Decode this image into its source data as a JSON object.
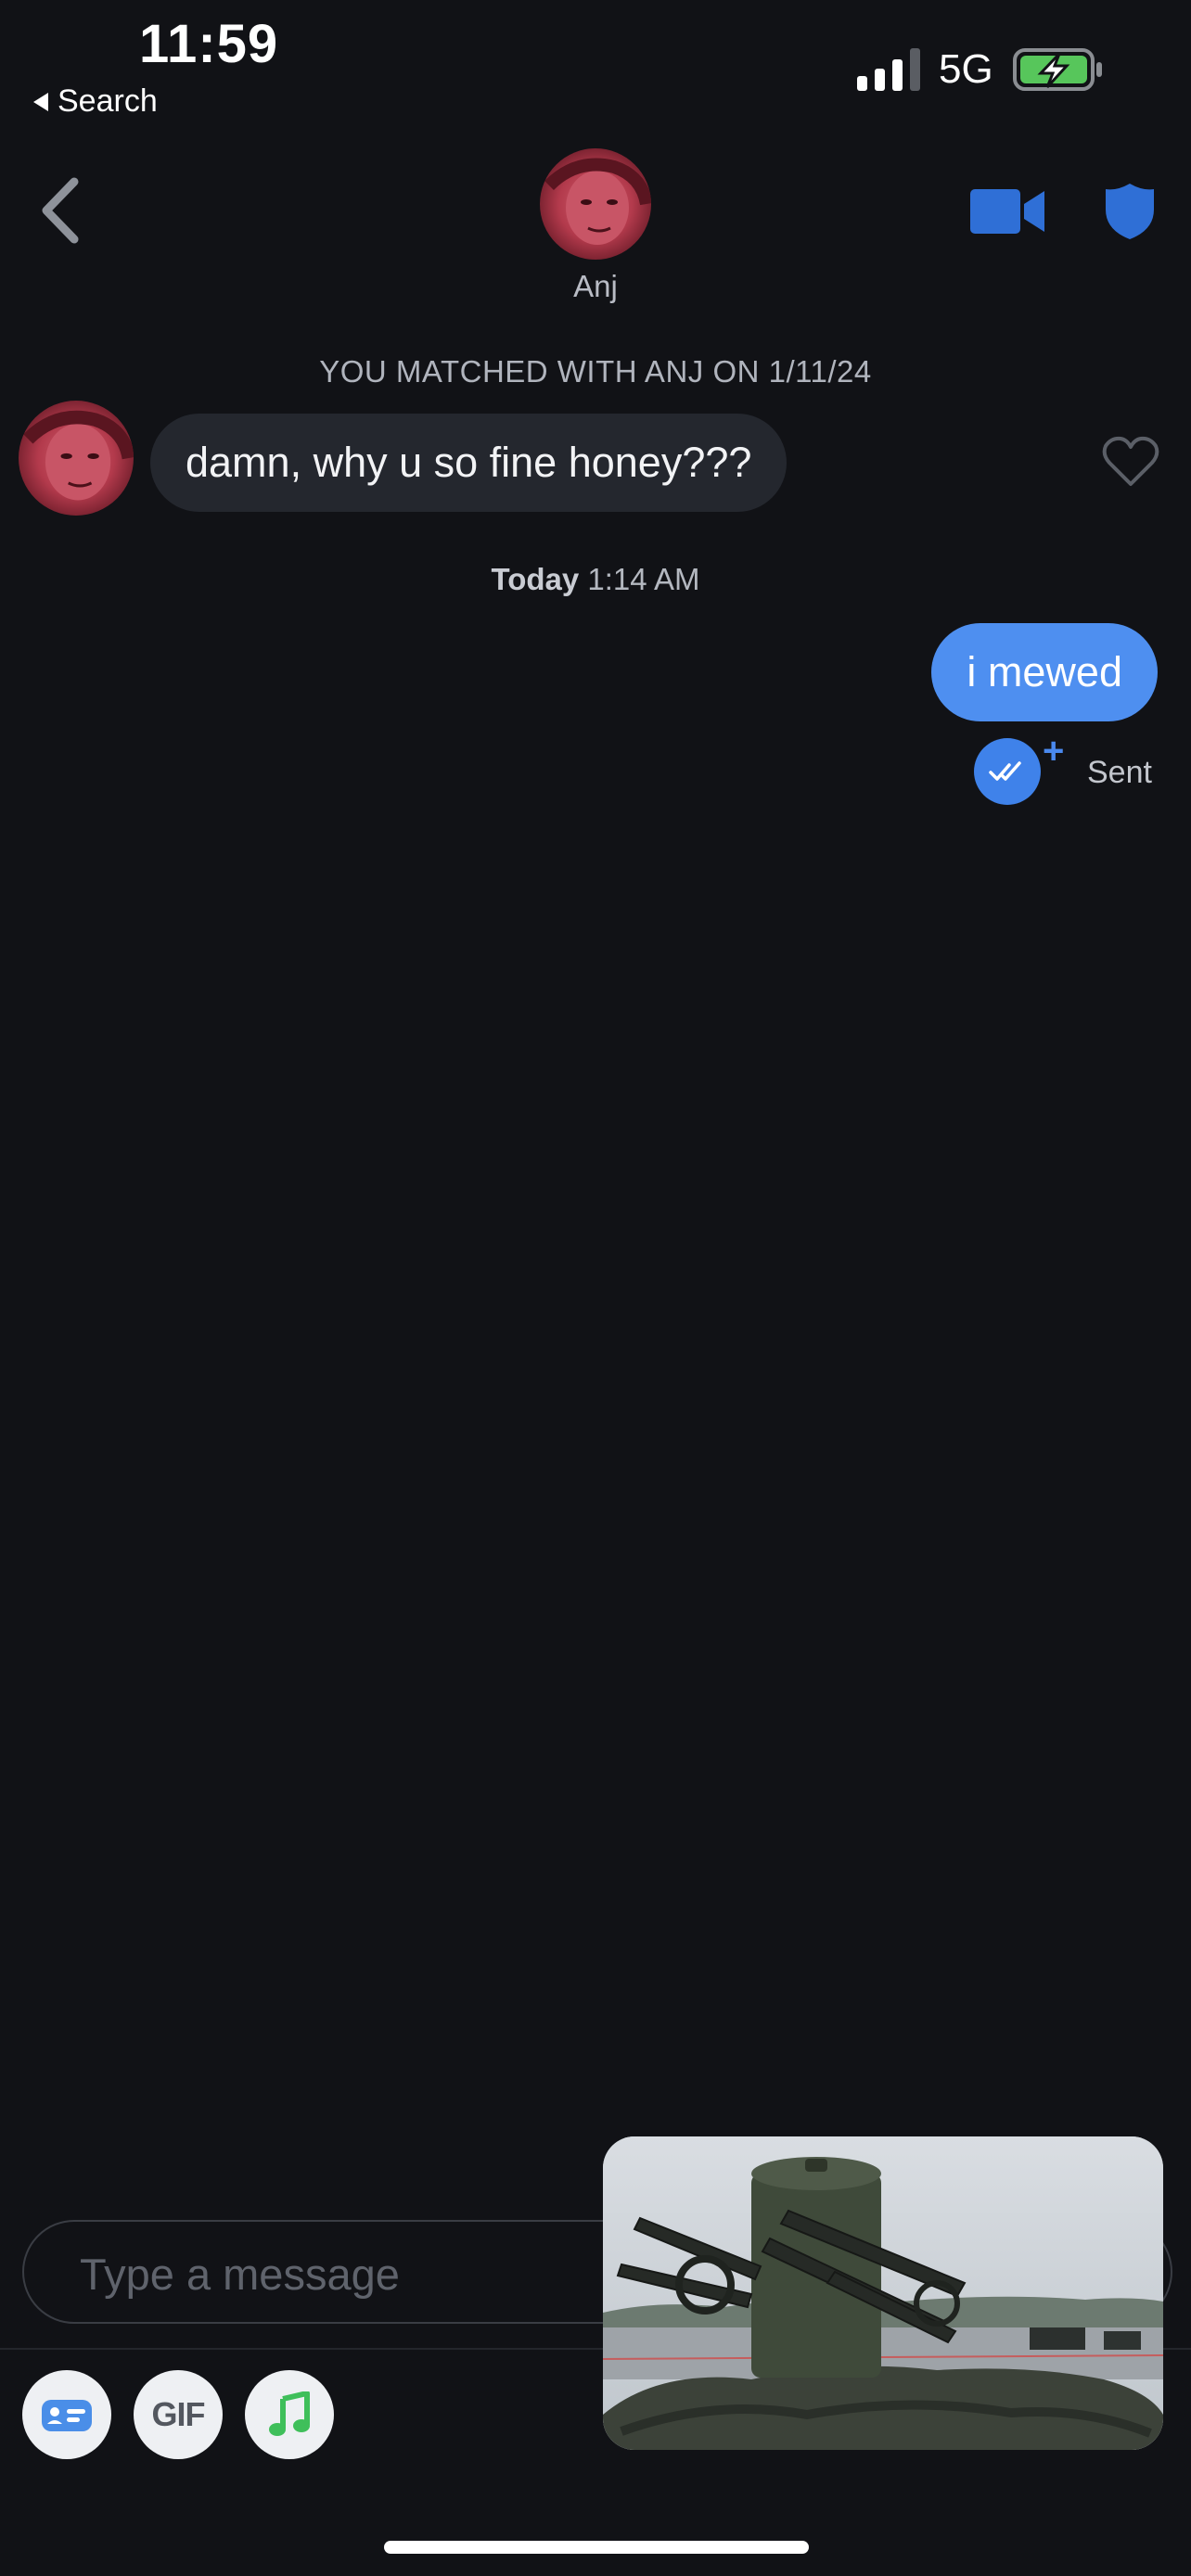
{
  "status_bar": {
    "time": "11:59",
    "back_app": "Search",
    "network": "5G",
    "icons": [
      "signal-bars-icon",
      "battery-charging-icon"
    ],
    "battery_color": "#57c65b"
  },
  "header": {
    "contact_name": "Anj",
    "icons": [
      "chevron-left-icon",
      "video-call-icon",
      "safety-shield-icon"
    ],
    "accent_color": "#2f6fd6"
  },
  "conversation": {
    "match_note": "YOU MATCHED WITH ANJ ON 1/11/24",
    "received_message": "damn, why u so fine honey???",
    "day_label": "Today",
    "day_time": "1:14 AM",
    "sent_message": "i mewed",
    "sent_status": "Sent",
    "read_badge_icon": "double-check-icon",
    "plus_mark": "+",
    "sent_bubble_color": "#4e8ff0",
    "received_bubble_color": "#24272e"
  },
  "composer": {
    "placeholder": "Type a message",
    "value": "",
    "tools": [
      {
        "name": "profile-card-icon"
      },
      {
        "label": "GIF"
      },
      {
        "name": "music-note-icon"
      }
    ]
  }
}
